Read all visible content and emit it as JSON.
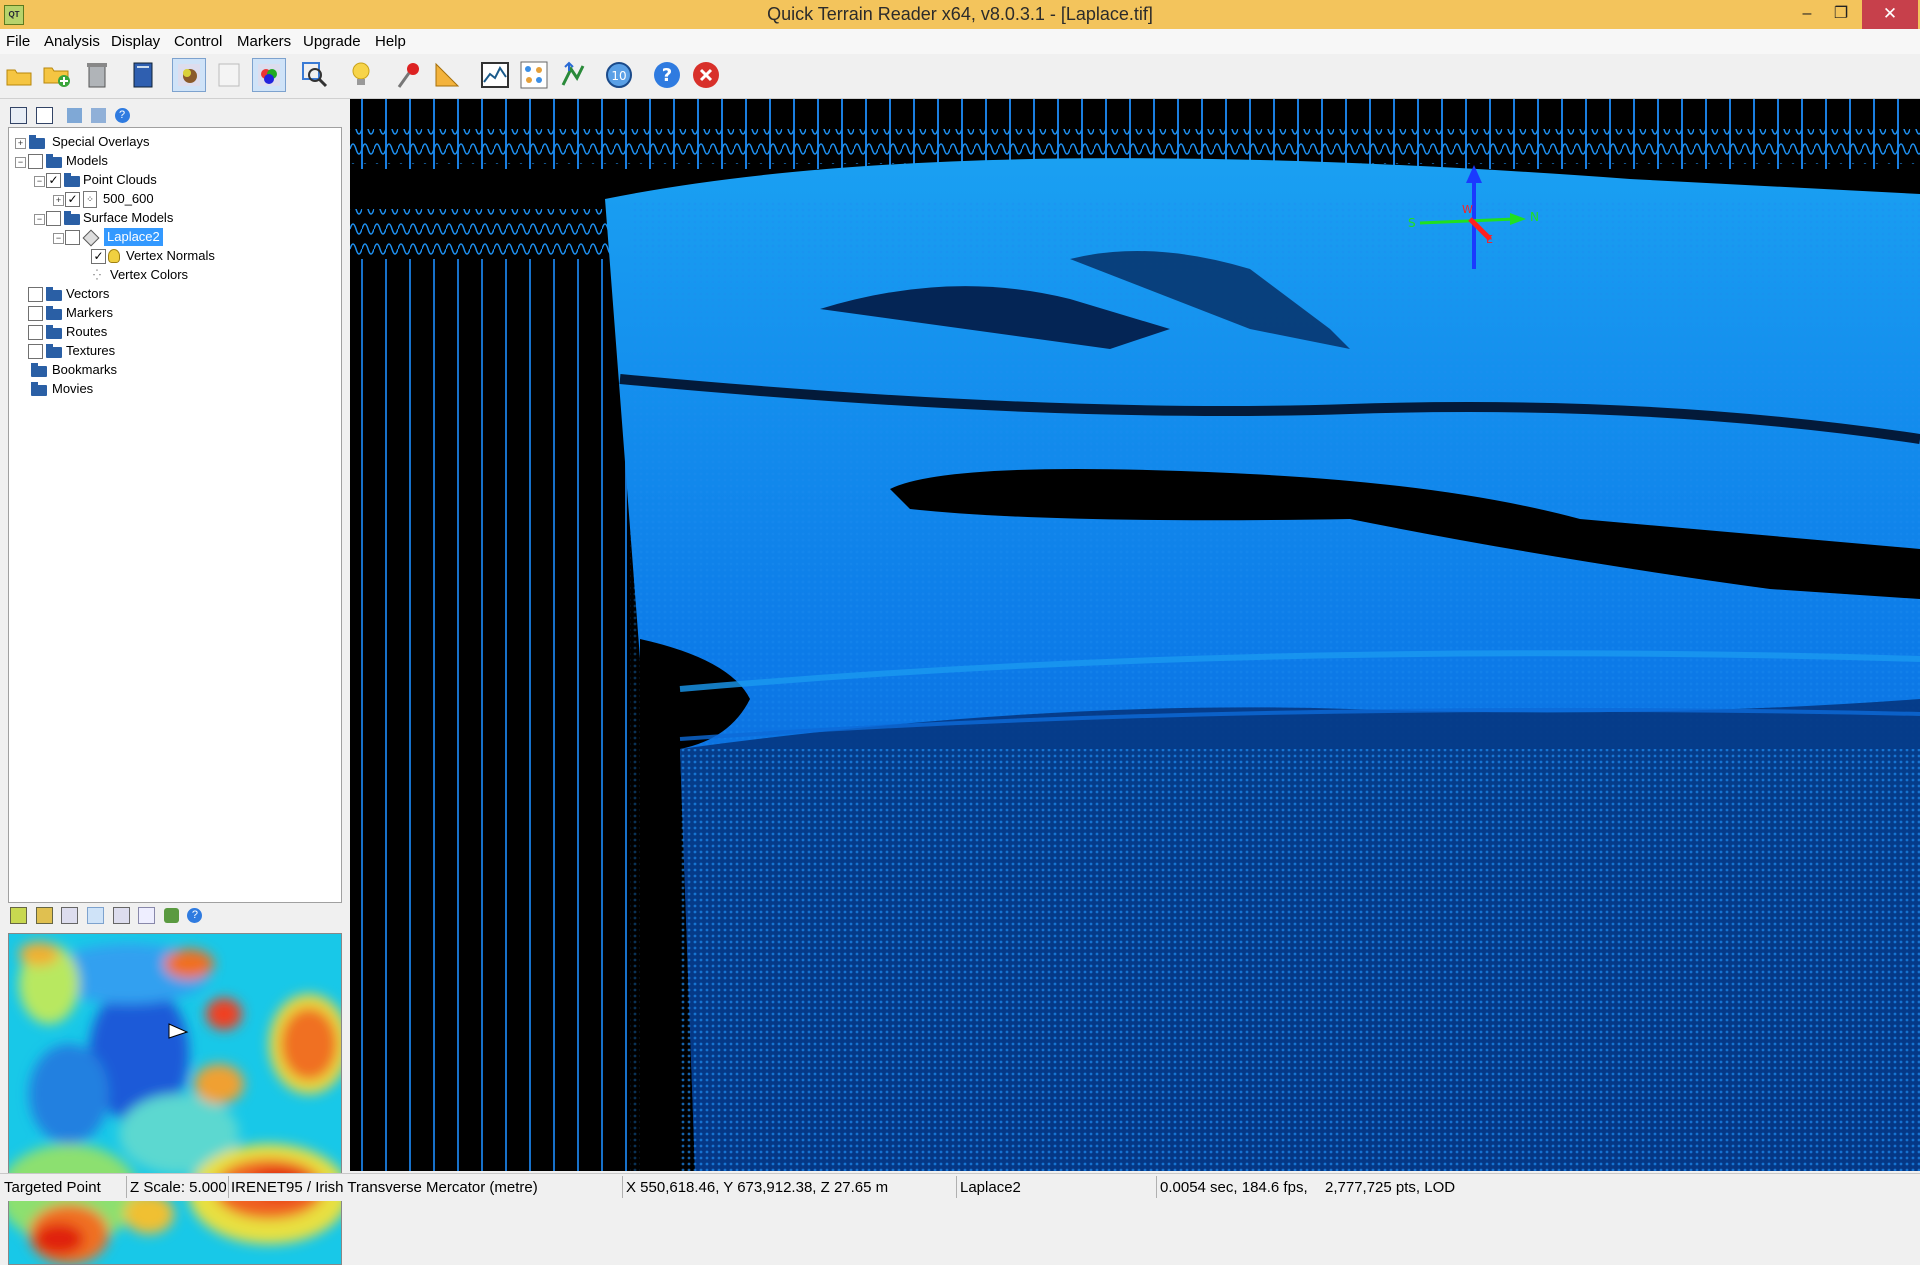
{
  "window": {
    "title": "Quick Terrain Reader x64, v8.0.3.1 - [Laplace.tif]",
    "app_icon": "QT",
    "minimize": "–",
    "maximize": "❐",
    "close": "✕"
  },
  "menu": [
    "File",
    "Analysis",
    "Display",
    "Control",
    "Markers",
    "Upgrade",
    "Help"
  ],
  "toolbar": [
    "open-file-icon",
    "add-data-icon",
    "delete-icon",
    "book-icon",
    "view-model-icon",
    "blank-page-icon",
    "color-model-icon",
    "zoom-extents-icon",
    "lightbulb-icon",
    "marker-pin-icon",
    "ruler-icon",
    "profile-icon",
    "point-cloud-icon",
    "export-icon",
    "time-icon",
    "help-icon",
    "stop-icon"
  ],
  "tree": {
    "special_overlays": "Special Overlays",
    "models": "Models",
    "point_clouds": "Point Clouds",
    "pc_500_600": "500_600",
    "surface_models": "Surface Models",
    "laplace2": "Laplace2",
    "vertex_normals": "Vertex Normals",
    "vertex_colors": "Vertex Colors",
    "vectors": "Vectors",
    "markers": "Markers",
    "routes": "Routes",
    "textures": "Textures",
    "bookmarks": "Bookmarks",
    "movies": "Movies"
  },
  "compass": {
    "north": "N",
    "south": "S",
    "east": "E",
    "west": "W"
  },
  "status": {
    "mode": "Targeted Point",
    "zscale": "Z Scale: 5.000C",
    "projection": "IRENET95 / Irish Transverse Mercator (metre)",
    "coords": "X 550,618.46, Y 673,912.38, Z 27.65 m",
    "model": "Laplace2",
    "perf": "0.0054 sec, 184.6 fps,",
    "points": "2,777,725 pts, LOD"
  }
}
